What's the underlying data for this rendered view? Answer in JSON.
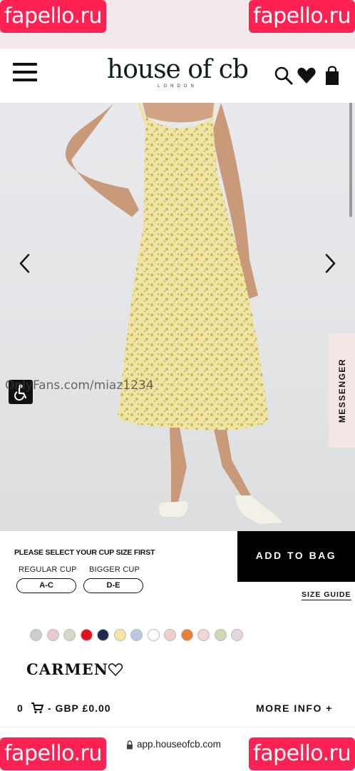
{
  "watermarks": {
    "top_left": "fapello.ru",
    "top_right": "fapello.ru",
    "bottom_left": "fapello.ru",
    "bottom_right": "fapello.ru",
    "overlay_text": "OnlyFans.com/miaz1234"
  },
  "header": {
    "logo_main": "house of cb",
    "logo_sub": "LONDON",
    "icons": [
      "menu-icon",
      "search-icon",
      "heart-icon",
      "shopping-bag-icon"
    ]
  },
  "hero": {
    "description_icons": [
      "chevron-left-icon",
      "chevron-right-icon",
      "accessibility-icon"
    ],
    "messenger_label": "MESSENGER"
  },
  "cup": {
    "title": "PLEASE SELECT YOUR CUP SIZE FIRST",
    "regular_label": "REGULAR CUP",
    "bigger_label": "BIGGER CUP",
    "regular_option": "A-C",
    "bigger_option": "D-E",
    "add_to_bag": "ADD TO BAG",
    "size_guide": "SIZE GUIDE"
  },
  "swatches": [
    {
      "name": "grey-floral",
      "color": "#c9d0c9"
    },
    {
      "name": "pink-floral",
      "color": "#e9c9cd"
    },
    {
      "name": "sage-floral",
      "color": "#d4d9c5"
    },
    {
      "name": "red",
      "color": "#e3101f"
    },
    {
      "name": "navy",
      "color": "#1e2a4d"
    },
    {
      "name": "yellow",
      "color": "#f6e7a3"
    },
    {
      "name": "blue-floral",
      "color": "#b9c9e3"
    },
    {
      "name": "white",
      "color": "#ffffff"
    },
    {
      "name": "blush",
      "color": "#efcfcf"
    },
    {
      "name": "orange",
      "color": "#e97f31"
    },
    {
      "name": "rose-floral",
      "color": "#f2d7d3"
    },
    {
      "name": "green-floral",
      "color": "#cfd8b4"
    },
    {
      "name": "lilac-floral",
      "color": "#e6d6e0"
    }
  ],
  "product": {
    "name": "CARMEN"
  },
  "price_bar": {
    "quantity": "0",
    "price": "- GBP £0.00",
    "more_info": "MORE INFO +"
  },
  "browser": {
    "url": "app.houseofcb.com"
  }
}
